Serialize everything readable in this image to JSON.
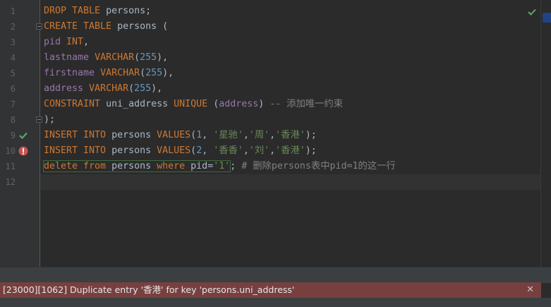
{
  "editor": {
    "line_numbers": [
      "1",
      "2",
      "3",
      "4",
      "5",
      "6",
      "7",
      "8",
      "9",
      "10",
      "11",
      "12"
    ],
    "lines": [
      [
        {
          "t": "DROP TABLE ",
          "c": "kw"
        },
        {
          "t": "persons;",
          "c": "id"
        }
      ],
      [
        {
          "t": "CREATE TABLE ",
          "c": "kw"
        },
        {
          "t": "persons (",
          "c": "id"
        }
      ],
      [
        {
          "t": "pid ",
          "c": "fn"
        },
        {
          "t": "INT",
          "c": "kw"
        },
        {
          "t": ",",
          "c": "id"
        }
      ],
      [
        {
          "t": "lastname ",
          "c": "fn"
        },
        {
          "t": "VARCHAR",
          "c": "kw"
        },
        {
          "t": "(",
          "c": "id"
        },
        {
          "t": "255",
          "c": "num"
        },
        {
          "t": "),",
          "c": "id"
        }
      ],
      [
        {
          "t": "firstname ",
          "c": "fn"
        },
        {
          "t": "VARCHAR",
          "c": "kw"
        },
        {
          "t": "(",
          "c": "id"
        },
        {
          "t": "255",
          "c": "num"
        },
        {
          "t": "),",
          "c": "id"
        }
      ],
      [
        {
          "t": "address ",
          "c": "fn"
        },
        {
          "t": "VARCHAR",
          "c": "kw"
        },
        {
          "t": "(",
          "c": "id"
        },
        {
          "t": "255",
          "c": "num"
        },
        {
          "t": "),",
          "c": "id"
        }
      ],
      [
        {
          "t": "CONSTRAINT ",
          "c": "kw"
        },
        {
          "t": "uni_address ",
          "c": "id"
        },
        {
          "t": "UNIQUE ",
          "c": "kw"
        },
        {
          "t": "(",
          "c": "id"
        },
        {
          "t": "address",
          "c": "fn"
        },
        {
          "t": ") ",
          "c": "id"
        },
        {
          "t": "-- 添加唯一约束",
          "c": "cmt"
        }
      ],
      [
        {
          "t": ");",
          "c": "id"
        }
      ],
      [
        {
          "t": "INSERT INTO ",
          "c": "kw"
        },
        {
          "t": "persons ",
          "c": "id"
        },
        {
          "t": "VALUES",
          "c": "kw"
        },
        {
          "t": "(",
          "c": "id"
        },
        {
          "t": "1",
          "c": "num"
        },
        {
          "t": ", ",
          "c": "id"
        },
        {
          "t": "'星驰'",
          "c": "str"
        },
        {
          "t": ",",
          "c": "id"
        },
        {
          "t": "'周'",
          "c": "str"
        },
        {
          "t": ",",
          "c": "id"
        },
        {
          "t": "'香港'",
          "c": "str"
        },
        {
          "t": ");",
          "c": "id"
        }
      ],
      [
        {
          "t": "INSERT INTO ",
          "c": "kw"
        },
        {
          "t": "persons ",
          "c": "id"
        },
        {
          "t": "VALUES",
          "c": "kw"
        },
        {
          "t": "(",
          "c": "id"
        },
        {
          "t": "2",
          "c": "num"
        },
        {
          "t": ", ",
          "c": "id"
        },
        {
          "t": "'香香'",
          "c": "str"
        },
        {
          "t": ",",
          "c": "id"
        },
        {
          "t": "'刘'",
          "c": "str"
        },
        {
          "t": ",",
          "c": "id"
        },
        {
          "t": "'香港'",
          "c": "str"
        },
        {
          "t": ");",
          "c": "id"
        }
      ],
      [
        {
          "t": "delete from ",
          "c": "kw"
        },
        {
          "t": "persons ",
          "c": "id"
        },
        {
          "t": "where ",
          "c": "kw"
        },
        {
          "t": "pid=",
          "c": "id"
        },
        {
          "t": "'1'",
          "c": "str"
        },
        {
          "t": "; ",
          "c": "id"
        },
        {
          "t": "# 删除persons表中pid=1的这一行",
          "c": "cmt"
        }
      ],
      []
    ],
    "gutter_icons": {
      "9": "success-check-icon",
      "10": "error-icon"
    },
    "fold_markers": [
      "2",
      "8"
    ],
    "status_icon": "check-icon"
  },
  "error_panel": {
    "message": "[23000][1062] Duplicate entry '香港' for key 'persons.uni_address'",
    "close_label": "✕"
  },
  "colors": {
    "keyword": "#cc7832",
    "number": "#6897bb",
    "string": "#6a8759",
    "field": "#9876aa",
    "comment": "#808080",
    "success": "#59a869",
    "error": "#c75450",
    "error_bar_bg": "#77403f"
  }
}
